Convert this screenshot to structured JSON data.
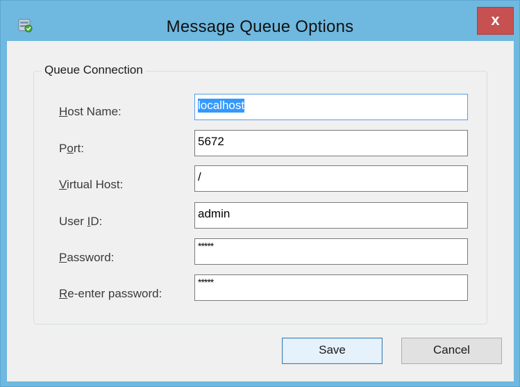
{
  "window": {
    "title": "Message Queue Options",
    "close_label": "x",
    "icon": "message-queue-app-icon"
  },
  "group": {
    "title": "Queue Connection"
  },
  "fields": {
    "host_name": {
      "label_pre": "",
      "label_key": "H",
      "label_post": "ost Name:",
      "value": "localhost"
    },
    "port": {
      "label_pre": "P",
      "label_key": "o",
      "label_post": "rt:",
      "value": "5672"
    },
    "virtual_host": {
      "label_pre": "",
      "label_key": "V",
      "label_post": "irtual Host:",
      "value": "/"
    },
    "user_id": {
      "label_pre": "User ",
      "label_key": "I",
      "label_post": "D:",
      "value": "admin"
    },
    "password": {
      "label_pre": "",
      "label_key": "P",
      "label_post": "assword:",
      "value": "*****"
    },
    "reenter_password": {
      "label_pre": "",
      "label_key": "R",
      "label_post": "e-enter password:",
      "value": "*****"
    }
  },
  "buttons": {
    "save": "Save",
    "cancel": "Cancel"
  },
  "colors": {
    "titlebar": "#6fb8df",
    "close_button": "#c75050",
    "dialog_background": "#f0f0f0",
    "selection": "#3399ff"
  }
}
